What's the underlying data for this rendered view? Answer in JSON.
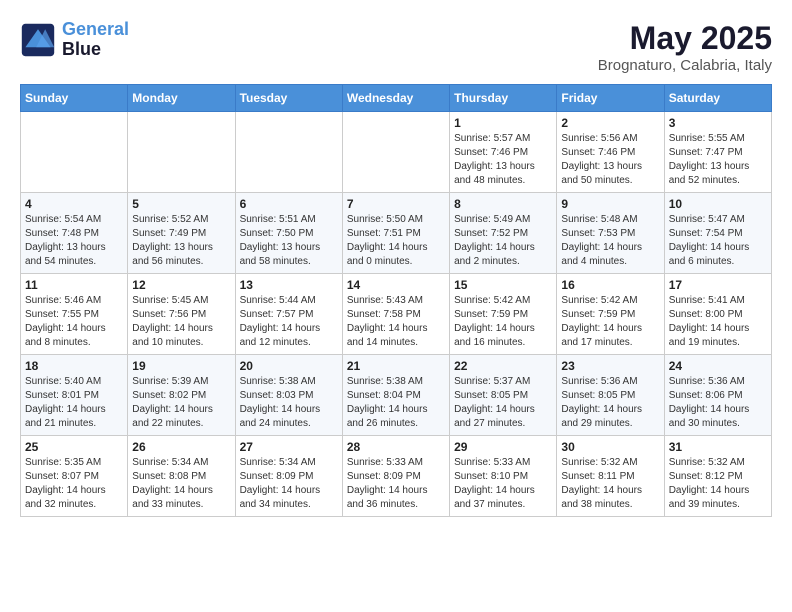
{
  "header": {
    "logo_line1": "General",
    "logo_line2": "Blue",
    "month": "May 2025",
    "location": "Brognaturo, Calabria, Italy"
  },
  "weekdays": [
    "Sunday",
    "Monday",
    "Tuesday",
    "Wednesday",
    "Thursday",
    "Friday",
    "Saturday"
  ],
  "weeks": [
    [
      null,
      null,
      null,
      null,
      {
        "day": "1",
        "sunrise": "5:57 AM",
        "sunset": "7:46 PM",
        "daylight": "13 hours and 48 minutes."
      },
      {
        "day": "2",
        "sunrise": "5:56 AM",
        "sunset": "7:46 PM",
        "daylight": "13 hours and 50 minutes."
      },
      {
        "day": "3",
        "sunrise": "5:55 AM",
        "sunset": "7:47 PM",
        "daylight": "13 hours and 52 minutes."
      }
    ],
    [
      {
        "day": "4",
        "sunrise": "5:54 AM",
        "sunset": "7:48 PM",
        "daylight": "13 hours and 54 minutes."
      },
      {
        "day": "5",
        "sunrise": "5:52 AM",
        "sunset": "7:49 PM",
        "daylight": "13 hours and 56 minutes."
      },
      {
        "day": "6",
        "sunrise": "5:51 AM",
        "sunset": "7:50 PM",
        "daylight": "13 hours and 58 minutes."
      },
      {
        "day": "7",
        "sunrise": "5:50 AM",
        "sunset": "7:51 PM",
        "daylight": "14 hours and 0 minutes."
      },
      {
        "day": "8",
        "sunrise": "5:49 AM",
        "sunset": "7:52 PM",
        "daylight": "14 hours and 2 minutes."
      },
      {
        "day": "9",
        "sunrise": "5:48 AM",
        "sunset": "7:53 PM",
        "daylight": "14 hours and 4 minutes."
      },
      {
        "day": "10",
        "sunrise": "5:47 AM",
        "sunset": "7:54 PM",
        "daylight": "14 hours and 6 minutes."
      }
    ],
    [
      {
        "day": "11",
        "sunrise": "5:46 AM",
        "sunset": "7:55 PM",
        "daylight": "14 hours and 8 minutes."
      },
      {
        "day": "12",
        "sunrise": "5:45 AM",
        "sunset": "7:56 PM",
        "daylight": "14 hours and 10 minutes."
      },
      {
        "day": "13",
        "sunrise": "5:44 AM",
        "sunset": "7:57 PM",
        "daylight": "14 hours and 12 minutes."
      },
      {
        "day": "14",
        "sunrise": "5:43 AM",
        "sunset": "7:58 PM",
        "daylight": "14 hours and 14 minutes."
      },
      {
        "day": "15",
        "sunrise": "5:42 AM",
        "sunset": "7:59 PM",
        "daylight": "14 hours and 16 minutes."
      },
      {
        "day": "16",
        "sunrise": "5:42 AM",
        "sunset": "7:59 PM",
        "daylight": "14 hours and 17 minutes."
      },
      {
        "day": "17",
        "sunrise": "5:41 AM",
        "sunset": "8:00 PM",
        "daylight": "14 hours and 19 minutes."
      }
    ],
    [
      {
        "day": "18",
        "sunrise": "5:40 AM",
        "sunset": "8:01 PM",
        "daylight": "14 hours and 21 minutes."
      },
      {
        "day": "19",
        "sunrise": "5:39 AM",
        "sunset": "8:02 PM",
        "daylight": "14 hours and 22 minutes."
      },
      {
        "day": "20",
        "sunrise": "5:38 AM",
        "sunset": "8:03 PM",
        "daylight": "14 hours and 24 minutes."
      },
      {
        "day": "21",
        "sunrise": "5:38 AM",
        "sunset": "8:04 PM",
        "daylight": "14 hours and 26 minutes."
      },
      {
        "day": "22",
        "sunrise": "5:37 AM",
        "sunset": "8:05 PM",
        "daylight": "14 hours and 27 minutes."
      },
      {
        "day": "23",
        "sunrise": "5:36 AM",
        "sunset": "8:05 PM",
        "daylight": "14 hours and 29 minutes."
      },
      {
        "day": "24",
        "sunrise": "5:36 AM",
        "sunset": "8:06 PM",
        "daylight": "14 hours and 30 minutes."
      }
    ],
    [
      {
        "day": "25",
        "sunrise": "5:35 AM",
        "sunset": "8:07 PM",
        "daylight": "14 hours and 32 minutes."
      },
      {
        "day": "26",
        "sunrise": "5:34 AM",
        "sunset": "8:08 PM",
        "daylight": "14 hours and 33 minutes."
      },
      {
        "day": "27",
        "sunrise": "5:34 AM",
        "sunset": "8:09 PM",
        "daylight": "14 hours and 34 minutes."
      },
      {
        "day": "28",
        "sunrise": "5:33 AM",
        "sunset": "8:09 PM",
        "daylight": "14 hours and 36 minutes."
      },
      {
        "day": "29",
        "sunrise": "5:33 AM",
        "sunset": "8:10 PM",
        "daylight": "14 hours and 37 minutes."
      },
      {
        "day": "30",
        "sunrise": "5:32 AM",
        "sunset": "8:11 PM",
        "daylight": "14 hours and 38 minutes."
      },
      {
        "day": "31",
        "sunrise": "5:32 AM",
        "sunset": "8:12 PM",
        "daylight": "14 hours and 39 minutes."
      }
    ]
  ]
}
